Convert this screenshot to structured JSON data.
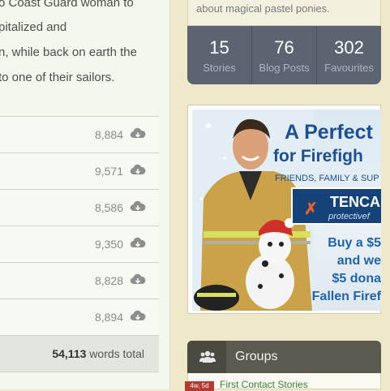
{
  "description": {
    "lines": [
      "o Coast Guard woman to",
      "pitalized and",
      "n, while back on earth the",
      "to one of their sailors."
    ]
  },
  "chapters": {
    "rows": [
      {
        "words": "8,884"
      },
      {
        "words": "9,571"
      },
      {
        "words": "8,586"
      },
      {
        "words": "9,350"
      },
      {
        "words": "8,828"
      },
      {
        "words": "8,894"
      }
    ],
    "download_icon": "cloud-download-icon",
    "total_number": "54,113",
    "total_suffix": " words total"
  },
  "sidebar": {
    "about_text": "about magical pastel ponies.",
    "stats": [
      {
        "value": "15",
        "label": "Stories"
      },
      {
        "value": "76",
        "label": "Blog Posts"
      },
      {
        "value": "302",
        "label": "Favourites"
      }
    ],
    "ad": {
      "headline_1": "A Perfect",
      "headline_2": "for Firefigh",
      "subline": "FRIENDS, FAMILY & SUP",
      "brand_name": "TENCA",
      "brand_sub": "protectivef",
      "buy_lines": [
        "Buy a $5",
        "and we",
        "$5 dona",
        "Fallen Firef"
      ]
    },
    "groups": {
      "title": "Groups",
      "icon": "users-icon",
      "first_group_badge": "4w, 5d",
      "first_group_link": "First Contact Stories"
    }
  },
  "colors": {
    "page_bg": "#efe9c9",
    "stats_bg": "#5b6470",
    "groups_header_bg": "#5b5a4e",
    "ad_blue": "#1c4f8f"
  }
}
